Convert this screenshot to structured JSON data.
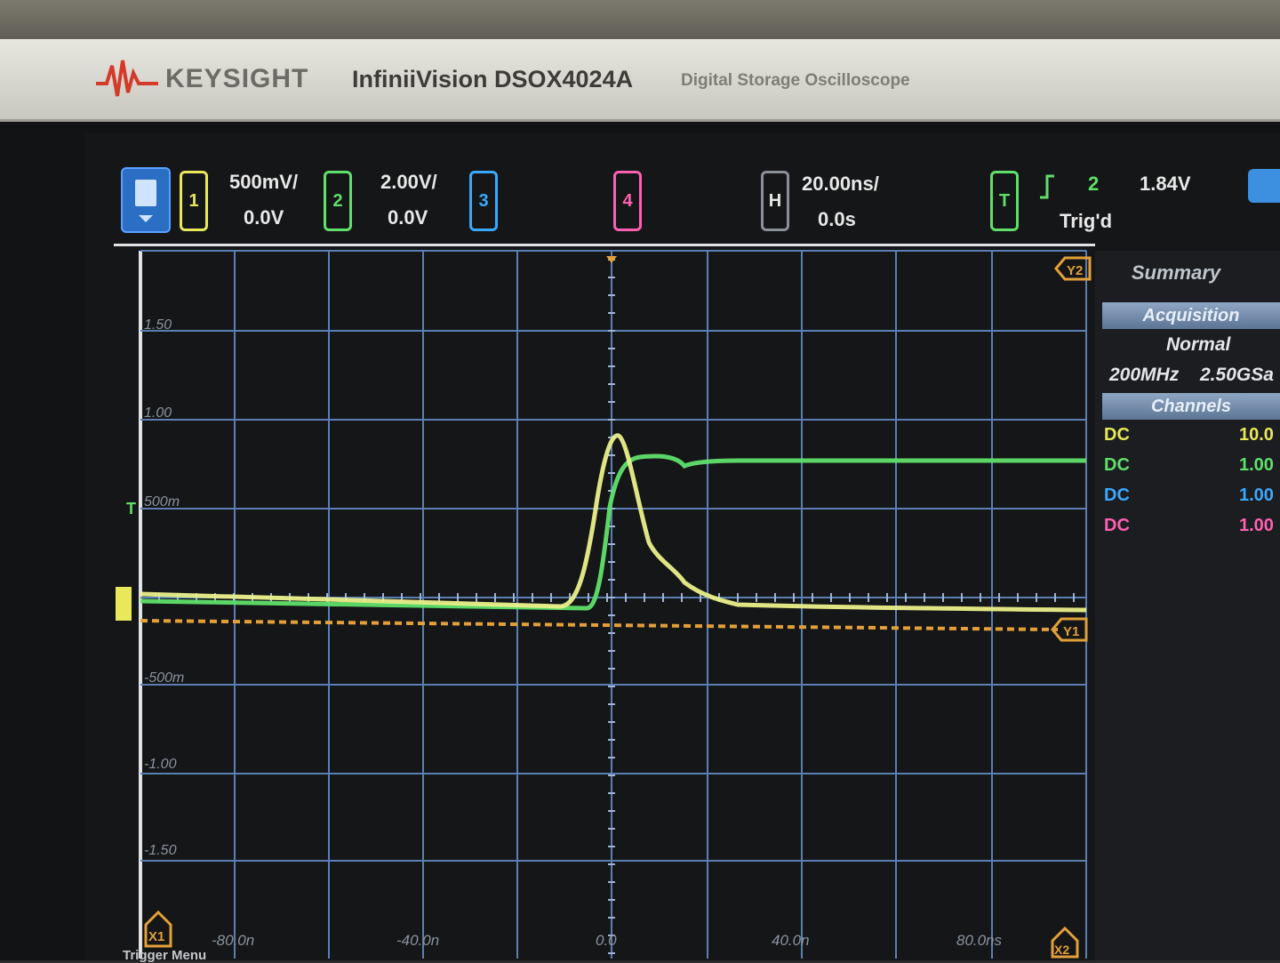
{
  "instrument": {
    "brand": "KEYSIGHT",
    "model": "InfiniiVision DSOX4024A",
    "description": "Digital Storage Oscilloscope"
  },
  "channels": [
    {
      "number": "1",
      "scale": "500mV/",
      "offset": "0.0V",
      "color": "#e8e85a"
    },
    {
      "number": "2",
      "scale": "2.00V/",
      "offset": "0.0V",
      "color": "#5fe06a"
    },
    {
      "number": "3",
      "color": "#3aa8ff"
    },
    {
      "number": "4",
      "color": "#ff5fb0"
    }
  ],
  "timebase": {
    "label": "H",
    "scale": "20.00ns/",
    "delay": "0.0s"
  },
  "trigger": {
    "label": "T",
    "source": "2",
    "level": "1.84V",
    "status": "Trig'd",
    "color": "#5fe06a"
  },
  "y_axis_labels": [
    "1.50",
    "1.00",
    "500m",
    "-500m",
    "-1.00",
    "-1.50"
  ],
  "x_axis_labels": [
    "-80.0n",
    "-40.0n",
    "0.0",
    "40.0n",
    "80.0ns"
  ],
  "side_panel": {
    "tab": "Summary",
    "acquisition_header": "Acquisition",
    "mode": "Normal",
    "bandwidth": "200MHz",
    "sample_rate": "2.50GSa",
    "channels_header": "Channels",
    "channel_rows": [
      {
        "coupling": "DC",
        "scale": "10.0",
        "color": "#e8e85a"
      },
      {
        "coupling": "DC",
        "scale": "1.00",
        "color": "#5fe06a"
      },
      {
        "coupling": "DC",
        "scale": "1.00",
        "color": "#3aa8ff"
      },
      {
        "coupling": "DC",
        "scale": "1.00",
        "color": "#ff5fb0"
      }
    ]
  },
  "cursor_labels": {
    "y1": "Y1",
    "y2": "Y2",
    "x1": "X1",
    "x2": "X2"
  },
  "footer": "Trigger Menu",
  "colors": {
    "grid": "#5b7fb3",
    "cursor": "#e3a03a",
    "accent": "#2a6fc4"
  }
}
